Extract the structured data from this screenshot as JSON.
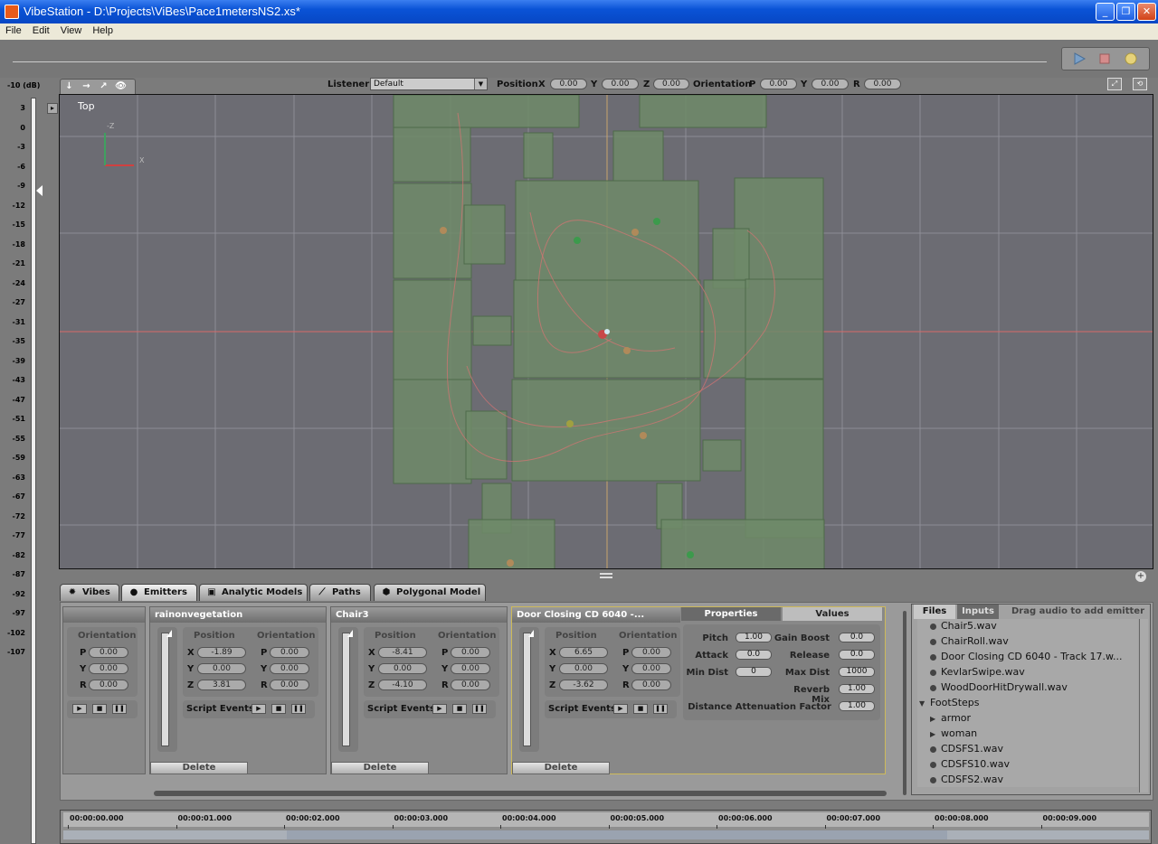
{
  "window": {
    "title": "VibeStation - D:\\Projects\\ViBes\\Pace1metersNS2.xs*",
    "min": "_",
    "max": "❐",
    "close": "✕"
  },
  "menu": [
    "File",
    "Edit",
    "View",
    "Help"
  ],
  "transport": {
    "play": "play-icon",
    "stop": "stop-icon",
    "record": "record-icon"
  },
  "vu": {
    "top_label": "-10 (dB)",
    "scale": [
      "3",
      "0",
      "-3",
      "-6",
      "-9",
      "-12",
      "-15",
      "-18",
      "-21",
      "-24",
      "-27",
      "-31",
      "-35",
      "-39",
      "-43",
      "-47",
      "-51",
      "-55",
      "-59",
      "-63",
      "-67",
      "-72",
      "-77",
      "-82",
      "-87",
      "-92",
      "-97",
      "-102",
      "-107"
    ]
  },
  "viewport_tabs": [
    "↓",
    "→",
    "↗",
    "👁"
  ],
  "listener": {
    "label": "Listener",
    "selected": "Default",
    "position_label": "Position",
    "orientation_label": "Orientation",
    "pos": {
      "x_label": "X",
      "x": "0.00",
      "y_label": "Y",
      "y": "0.00",
      "z_label": "Z",
      "z": "0.00"
    },
    "ori": {
      "p_label": "P",
      "p": "0.00",
      "y_label": "Y",
      "y": "0.00",
      "r_label": "R",
      "r": "0.00"
    }
  },
  "viewport": {
    "label": "Top",
    "axis_z": "-Z",
    "axis_x": "X"
  },
  "tabs": [
    {
      "label": "Vibes",
      "icon": "gear-icon"
    },
    {
      "label": "Emitters",
      "icon": "dot-icon"
    },
    {
      "label": "Analytic Models",
      "icon": "cube-icon"
    },
    {
      "label": "Paths",
      "icon": "path-icon"
    },
    {
      "label": "Polygonal Model",
      "icon": "polygon-icon"
    }
  ],
  "emitters": [
    {
      "name": "",
      "position_label": "Position",
      "orientation_label": "Orientation",
      "x": "",
      "y": "",
      "z": "",
      "p": "0.00",
      "oy": "0.00",
      "r": "0.00",
      "script_events": "",
      "delete": ""
    },
    {
      "name": "rainonvegetation",
      "position_label": "Position",
      "orientation_label": "Orientation",
      "x": "-1.89",
      "y": "0.00",
      "z": "3.81",
      "p": "0.00",
      "oy": "0.00",
      "r": "0.00",
      "script_events": "Script Events",
      "delete": "Delete"
    },
    {
      "name": "Chair3",
      "position_label": "Position",
      "orientation_label": "Orientation",
      "x": "-8.41",
      "y": "0.00",
      "z": "-4.10",
      "p": "0.00",
      "oy": "0.00",
      "r": "0.00",
      "script_events": "Script Events",
      "delete": "Delete"
    },
    {
      "name": "Door Closing CD 6040 -...",
      "position_label": "Position",
      "orientation_label": "Orientation",
      "x": "6.65",
      "y": "0.00",
      "z": "-3.62",
      "p": "0.00",
      "oy": "0.00",
      "r": "0.00",
      "script_events": "Script Events",
      "delete": "Delete"
    }
  ],
  "axis_labels": {
    "x": "X",
    "y": "Y",
    "z": "Z",
    "p": "P",
    "r": "R"
  },
  "properties": {
    "header_props": "Properties",
    "header_values": "Values",
    "pitch_label": "Pitch",
    "pitch": "1.00",
    "attack_label": "Attack",
    "attack": "0.0",
    "min_dist_label": "Min Dist",
    "min_dist": "0",
    "gain_boost_label": "Gain Boost",
    "gain_boost": "0.0",
    "release_label": "Release",
    "release": "0.0",
    "max_dist_label": "Max Dist",
    "max_dist": "1000",
    "reverb_mix_label": "Reverb Mix",
    "reverb_mix": "1.00",
    "dist_att_label": "Distance Attenuation Factor",
    "dist_att": "1.00"
  },
  "files": {
    "tab_files": "Files",
    "tab_inputs": "Inputs",
    "hint": "Drag audio to add emitter ...",
    "items": [
      {
        "label": "Chair5.wav",
        "kind": "file",
        "indent": 1
      },
      {
        "label": "ChairRoll.wav",
        "kind": "file",
        "indent": 1
      },
      {
        "label": "Door Closing CD 6040 - Track 17.w...",
        "kind": "file",
        "indent": 1
      },
      {
        "label": "KevlarSwipe.wav",
        "kind": "file",
        "indent": 1
      },
      {
        "label": "WoodDoorHitDrywall.wav",
        "kind": "file",
        "indent": 1
      },
      {
        "label": "FootSteps",
        "kind": "open-folder",
        "indent": 0
      },
      {
        "label": "armor",
        "kind": "closed-folder",
        "indent": 1
      },
      {
        "label": "woman",
        "kind": "closed-folder",
        "indent": 1
      },
      {
        "label": "CDSFS1.wav",
        "kind": "file",
        "indent": 1
      },
      {
        "label": "CDSFS10.wav",
        "kind": "file",
        "indent": 1
      },
      {
        "label": "CDSFS2.wav",
        "kind": "file",
        "indent": 1
      }
    ]
  },
  "timeline": [
    "00:00:00.000",
    "00:00:01.000",
    "00:00:02.000",
    "00:00:03.000",
    "00:00:04.000",
    "00:00:05.000",
    "00:00:06.000",
    "00:00:07.000",
    "00:00:08.000",
    "00:00:09.000"
  ]
}
